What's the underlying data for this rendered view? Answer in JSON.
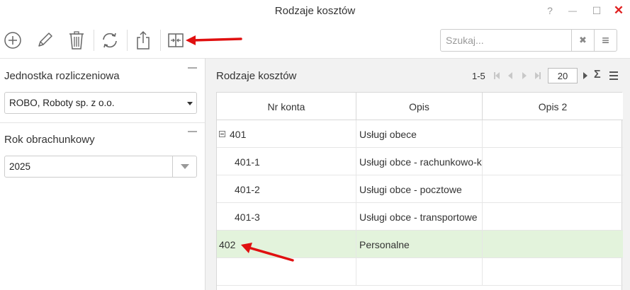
{
  "window": {
    "title": "Rodzaje kosztów",
    "help_label": "?",
    "minimize_label": "—",
    "maximize_label": "☐",
    "close_label": "✕",
    "close_color": "#e02020"
  },
  "toolbar": {
    "buttons": [
      "add-icon",
      "edit-icon",
      "delete-icon",
      "refresh-icon",
      "export-icon",
      "split-view-icon"
    ]
  },
  "search": {
    "value": "",
    "placeholder": "Szukaj...",
    "clear_label": "✖",
    "menu_label": "≡"
  },
  "left_panel": {
    "unit": {
      "label": "Jednostka rozliczeniowa",
      "value": "ROBO, Roboty sp. z o.o."
    },
    "year": {
      "label": "Rok obrachunkowy",
      "value": "2025"
    }
  },
  "grid": {
    "title": "Rodzaje kosztów",
    "pager": {
      "range": "1-5",
      "page_size": "20",
      "sigma_label": "Σ"
    },
    "columns": [
      "Nr konta",
      "Opis",
      "Opis 2"
    ],
    "rows": [
      {
        "nr": "401",
        "opis": "Usługi obece",
        "opis2": "",
        "expanded": true,
        "indent": false,
        "selected": false
      },
      {
        "nr": "401-1",
        "opis": "Usługi obce - rachunkowo-k",
        "opis2": "",
        "expanded": false,
        "indent": true,
        "selected": false
      },
      {
        "nr": "401-2",
        "opis": "Usługi obce - pocztowe",
        "opis2": "",
        "expanded": false,
        "indent": true,
        "selected": false
      },
      {
        "nr": "401-3",
        "opis": "Usługi obce - transportowe",
        "opis2": "",
        "expanded": false,
        "indent": true,
        "selected": false
      },
      {
        "nr": "402",
        "opis": "Personalne",
        "opis2": "",
        "expanded": false,
        "indent": false,
        "selected": true
      }
    ],
    "selected_row_color": "#e3f3dc"
  },
  "annotation": {
    "arrow_color": "#e01010"
  }
}
